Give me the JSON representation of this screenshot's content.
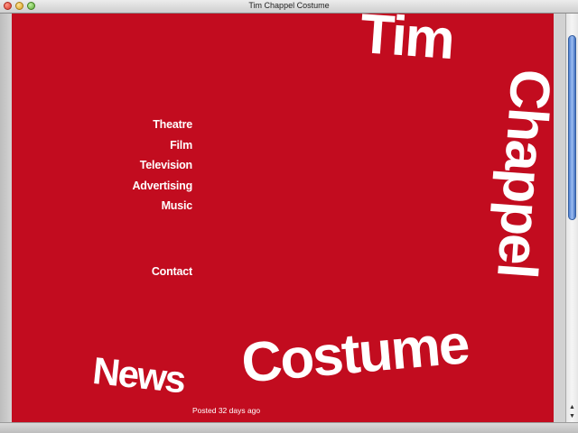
{
  "window": {
    "title": "Tim Chappel Costume"
  },
  "nav": {
    "items": [
      {
        "label": "Theatre"
      },
      {
        "label": "Film"
      },
      {
        "label": "Television"
      },
      {
        "label": "Advertising"
      },
      {
        "label": "Music"
      }
    ],
    "contact": "Contact"
  },
  "logo": {
    "word1": "Tim",
    "word2": "Chappel",
    "word3": "Costume"
  },
  "news": {
    "heading": "News",
    "posted": "Posted 32 days ago"
  },
  "scrollbar": {
    "up_icon": "triangle-up",
    "down_icon": "triangle-down"
  },
  "colors": {
    "background": "#c20c1f",
    "text": "#ffffff"
  }
}
